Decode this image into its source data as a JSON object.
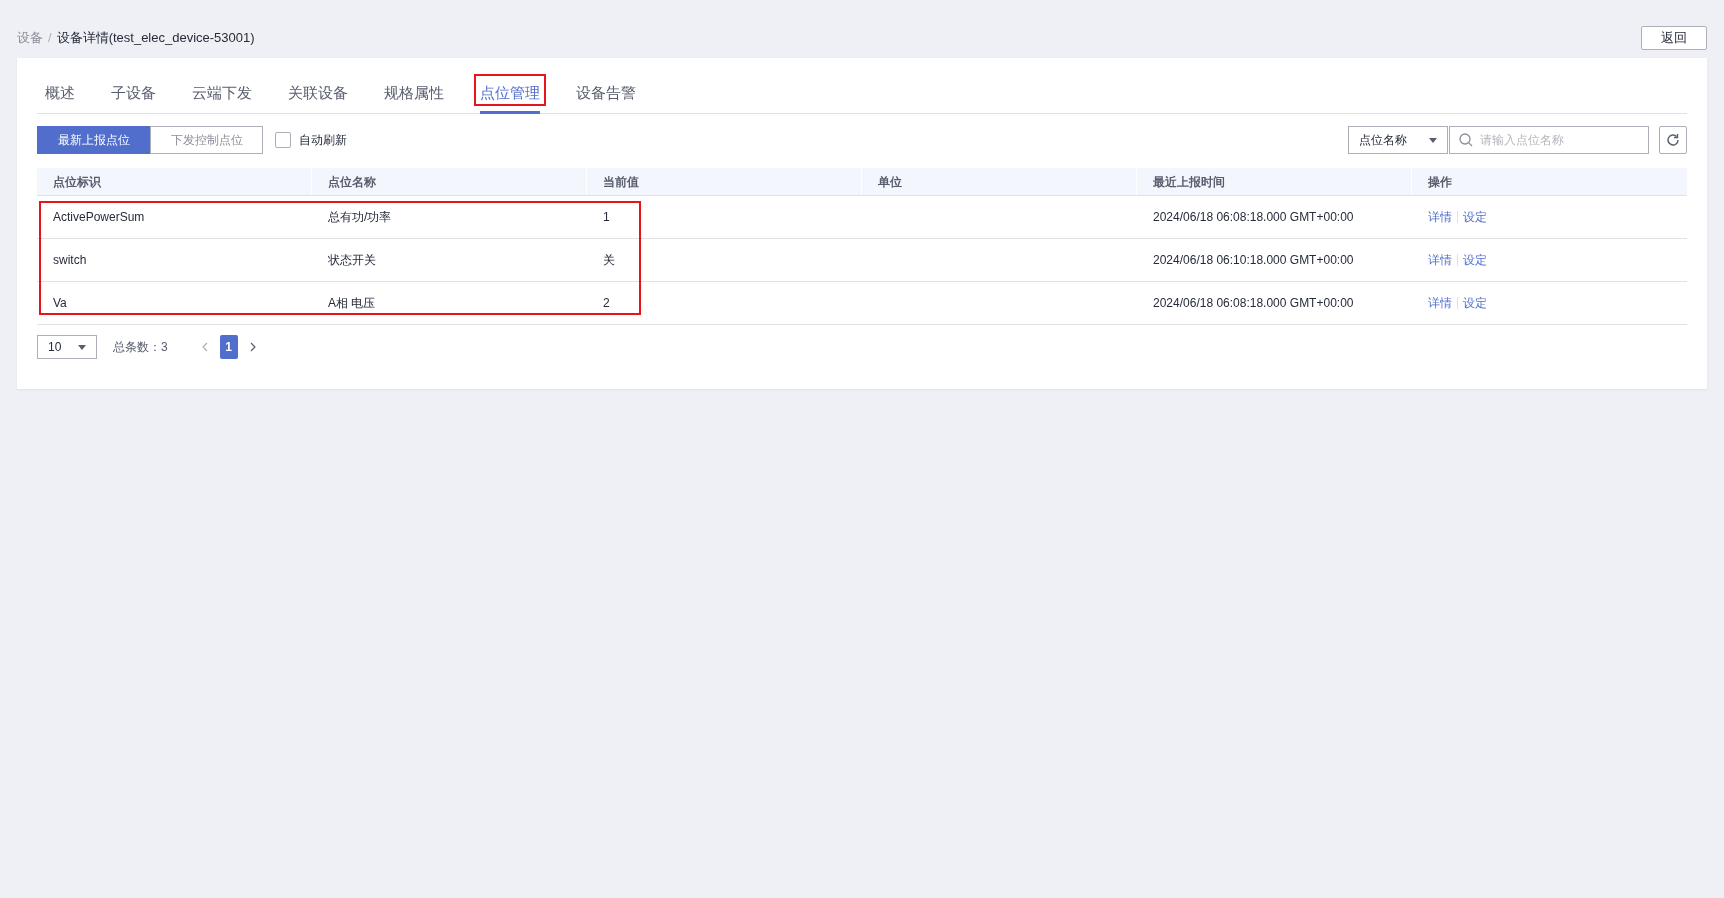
{
  "breadcrumb_separator": "/",
  "breadcrumb": [
    {
      "label": "设备",
      "current": false
    },
    {
      "label": "设备详情(test_elec_device-53001)",
      "current": true
    }
  ],
  "back_button": "返回",
  "tabs": [
    {
      "label": "概述",
      "selected": false,
      "framed": false
    },
    {
      "label": "子设备",
      "selected": false,
      "framed": false
    },
    {
      "label": "云端下发",
      "selected": false,
      "framed": false
    },
    {
      "label": "关联设备",
      "selected": false,
      "framed": false
    },
    {
      "label": "规格属性",
      "selected": false,
      "framed": false
    },
    {
      "label": "点位管理",
      "selected": true,
      "framed": true
    },
    {
      "label": "设备告警",
      "selected": false,
      "framed": false
    }
  ],
  "mode_buttons": [
    {
      "label": "最新上报点位",
      "selected": true
    },
    {
      "label": "下发控制点位",
      "selected": false
    }
  ],
  "auto_refresh": {
    "label": "自动刷新",
    "checked": false
  },
  "search": {
    "field_select": "点位名称",
    "placeholder": "请输入点位名称"
  },
  "table": {
    "columns": [
      "点位标识",
      "点位名称",
      "当前值",
      "单位",
      "最近上报时间",
      "操作"
    ],
    "rows_framed": true,
    "rows": [
      {
        "id": "ActivePowerSum",
        "name": "总有功/功率",
        "value": "1",
        "time": "2024/06/18 06:08:18.000 GMT+00:00",
        "actions": [
          "详情",
          "设定"
        ]
      },
      {
        "id": "switch",
        "name": "状态开关",
        "value": "关",
        "time": "2024/06/18 06:10:18.000 GMT+00:00",
        "actions": [
          "详情",
          "设定"
        ]
      },
      {
        "id": "Va",
        "name": "A相 电压",
        "value": "2",
        "time": "2024/06/18 06:08:18.000 GMT+00:00",
        "actions": [
          "详情",
          "设定"
        ]
      }
    ]
  },
  "pagination": {
    "page_size": "10",
    "total": "总条数：3",
    "pages": [
      {
        "label": "1",
        "selected": true
      }
    ]
  }
}
